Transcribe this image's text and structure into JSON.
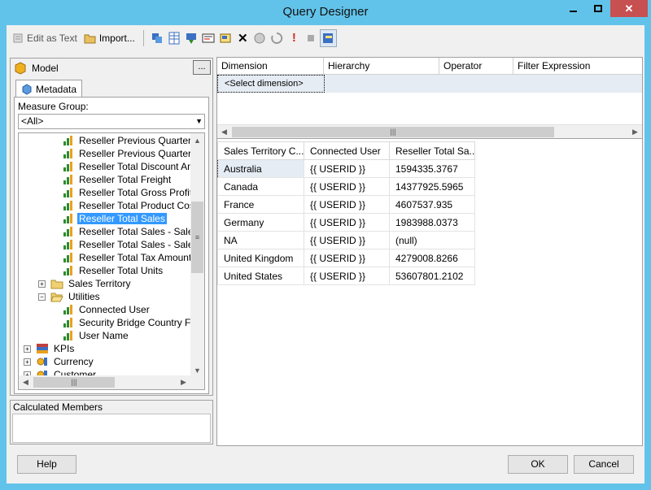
{
  "window": {
    "title": "Query Designer",
    "controls": {
      "minimize": "—",
      "maximize": "□",
      "close": "✕"
    }
  },
  "toolbar": {
    "edit_as_text": "Edit as Text",
    "import": "Import..."
  },
  "left": {
    "cube_label": "Model",
    "browse_label": "...",
    "tab_label": "Metadata",
    "measure_group_label": "Measure Group:",
    "measure_group_value": "<All>",
    "tree": [
      {
        "label": "Reseller Previous Quarter",
        "icon": "measure"
      },
      {
        "label": "Reseller Previous Quarter",
        "icon": "measure"
      },
      {
        "label": "Reseller Total Discount Am",
        "icon": "measure"
      },
      {
        "label": "Reseller Total Freight",
        "icon": "measure"
      },
      {
        "label": "Reseller Total Gross Profit",
        "icon": "measure"
      },
      {
        "label": "Reseller Total Product Cos",
        "icon": "measure"
      },
      {
        "label": "Reseller Total Sales",
        "icon": "measure",
        "selected": true
      },
      {
        "label": "Reseller Total Sales - Sales",
        "icon": "measure"
      },
      {
        "label": "Reseller Total Sales - Sales",
        "icon": "measure"
      },
      {
        "label": "Reseller Total Tax Amount",
        "icon": "measure"
      },
      {
        "label": "Reseller Total Units",
        "icon": "measure"
      },
      {
        "label": "Sales Territory",
        "icon": "folder",
        "expander": "+"
      },
      {
        "label": "Utilities",
        "icon": "folder-open",
        "expander": "−"
      },
      {
        "label": "Connected User",
        "icon": "measure"
      },
      {
        "label": "Security Bridge Country F",
        "icon": "measure"
      },
      {
        "label": "User Name",
        "icon": "measure"
      },
      {
        "label": "KPIs",
        "icon": "kpi",
        "expander": "+"
      },
      {
        "label": "Currency",
        "icon": "dimension",
        "expander": "+"
      },
      {
        "label": "Customer",
        "icon": "dimension",
        "expander": "+"
      }
    ],
    "calculated_members_label": "Calculated Members"
  },
  "filter": {
    "headers": [
      "Dimension",
      "Hierarchy",
      "Operator",
      "Filter Expression"
    ],
    "select_dimension": "<Select dimension>"
  },
  "results": {
    "headers": [
      "Sales Territory C...",
      "Connected User",
      "Reseller Total Sa..."
    ],
    "rows": [
      [
        "Australia",
        "{{ USERID }}",
        "1594335.3767"
      ],
      [
        "Canada",
        "{{ USERID }}",
        "14377925.5965"
      ],
      [
        "France",
        "{{ USERID }}",
        "4607537.935"
      ],
      [
        "Germany",
        "{{ USERID }}",
        "1983988.0373"
      ],
      [
        "NA",
        "{{ USERID }}",
        "(null)"
      ],
      [
        "United Kingdom",
        "{{ USERID }}",
        "4279008.8266"
      ],
      [
        "United States",
        "{{ USERID }}",
        "53607801.2102"
      ]
    ]
  },
  "buttons": {
    "help": "Help",
    "ok": "OK",
    "cancel": "Cancel"
  },
  "colors": {
    "titlebar": "#62c3ea",
    "selection": "#3399ff",
    "measure_icon": "#2e8b2e",
    "folder": "#e8c060"
  }
}
